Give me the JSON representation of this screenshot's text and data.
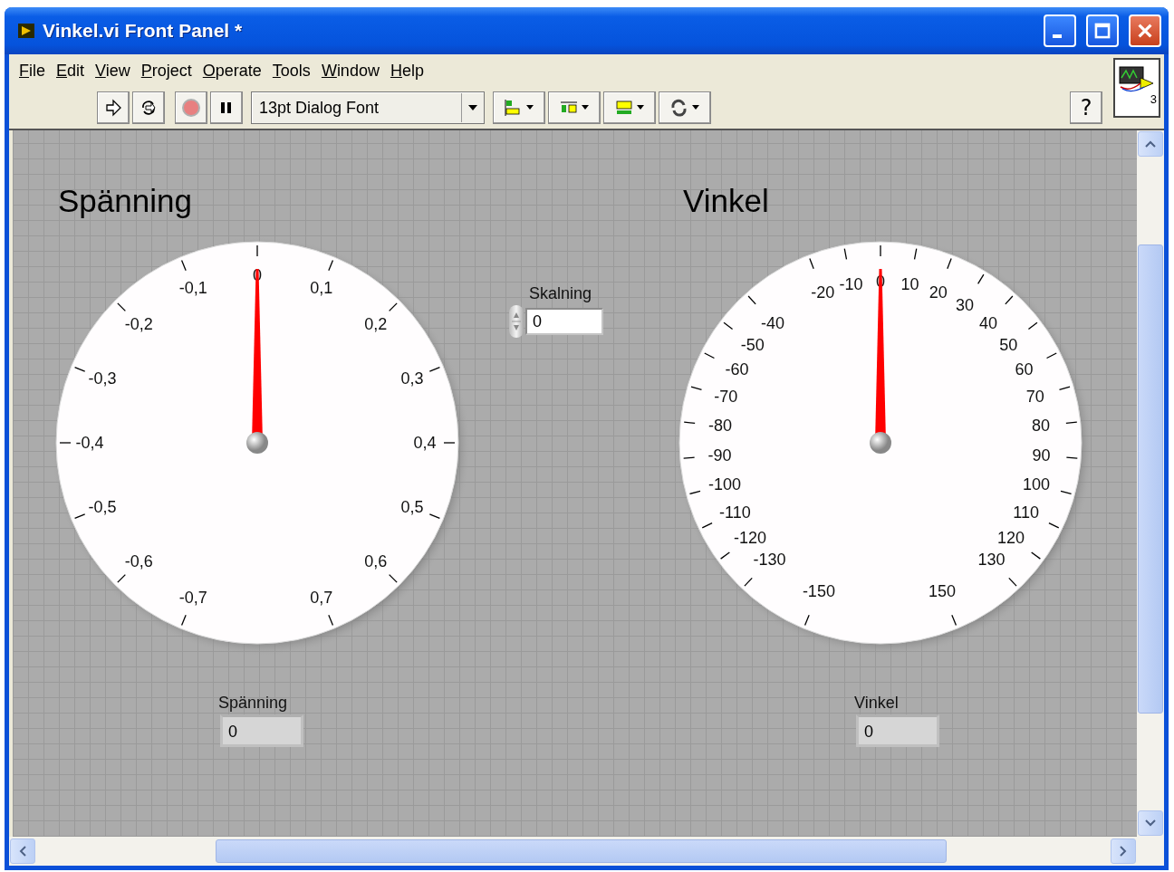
{
  "window": {
    "title": "Vinkel.vi Front Panel *"
  },
  "menu": [
    "File",
    "Edit",
    "View",
    "Project",
    "Operate",
    "Tools",
    "Window",
    "Help"
  ],
  "toolbar": {
    "font": "13pt Dialog Font",
    "help": "?"
  },
  "connector_pane": {
    "label": "3"
  },
  "gauges": [
    {
      "label": "Spänning",
      "level": 0.5,
      "scale": [
        "0",
        "0,1",
        "0,2",
        "0,3",
        "0,4",
        "0,5",
        "0,6",
        "0,7",
        "-0,1",
        "-0,2",
        "-0,3",
        "-0,4",
        "-0,5",
        "-0,6",
        "-0,7"
      ]
    },
    {
      "label": "Vinkel",
      "level": 0.5,
      "scale": [
        "0",
        "10",
        "20",
        "30",
        "40",
        "50",
        "60",
        "70",
        "80",
        "90",
        "100",
        "110",
        "120",
        "130",
        "150",
        "-10",
        "-20",
        "-40",
        "-50",
        "-60",
        "-70",
        "-80",
        "-90",
        "-100",
        "-110",
        "-120",
        "-130",
        "-150"
      ]
    }
  ],
  "numerics": [
    {
      "kind": "control",
      "label": "Skalning",
      "value": "0"
    },
    {
      "kind": "indicator",
      "label": "Spänning",
      "value": "0"
    },
    {
      "kind": "indicator",
      "label": "Vinkel",
      "value": "0"
    }
  ]
}
